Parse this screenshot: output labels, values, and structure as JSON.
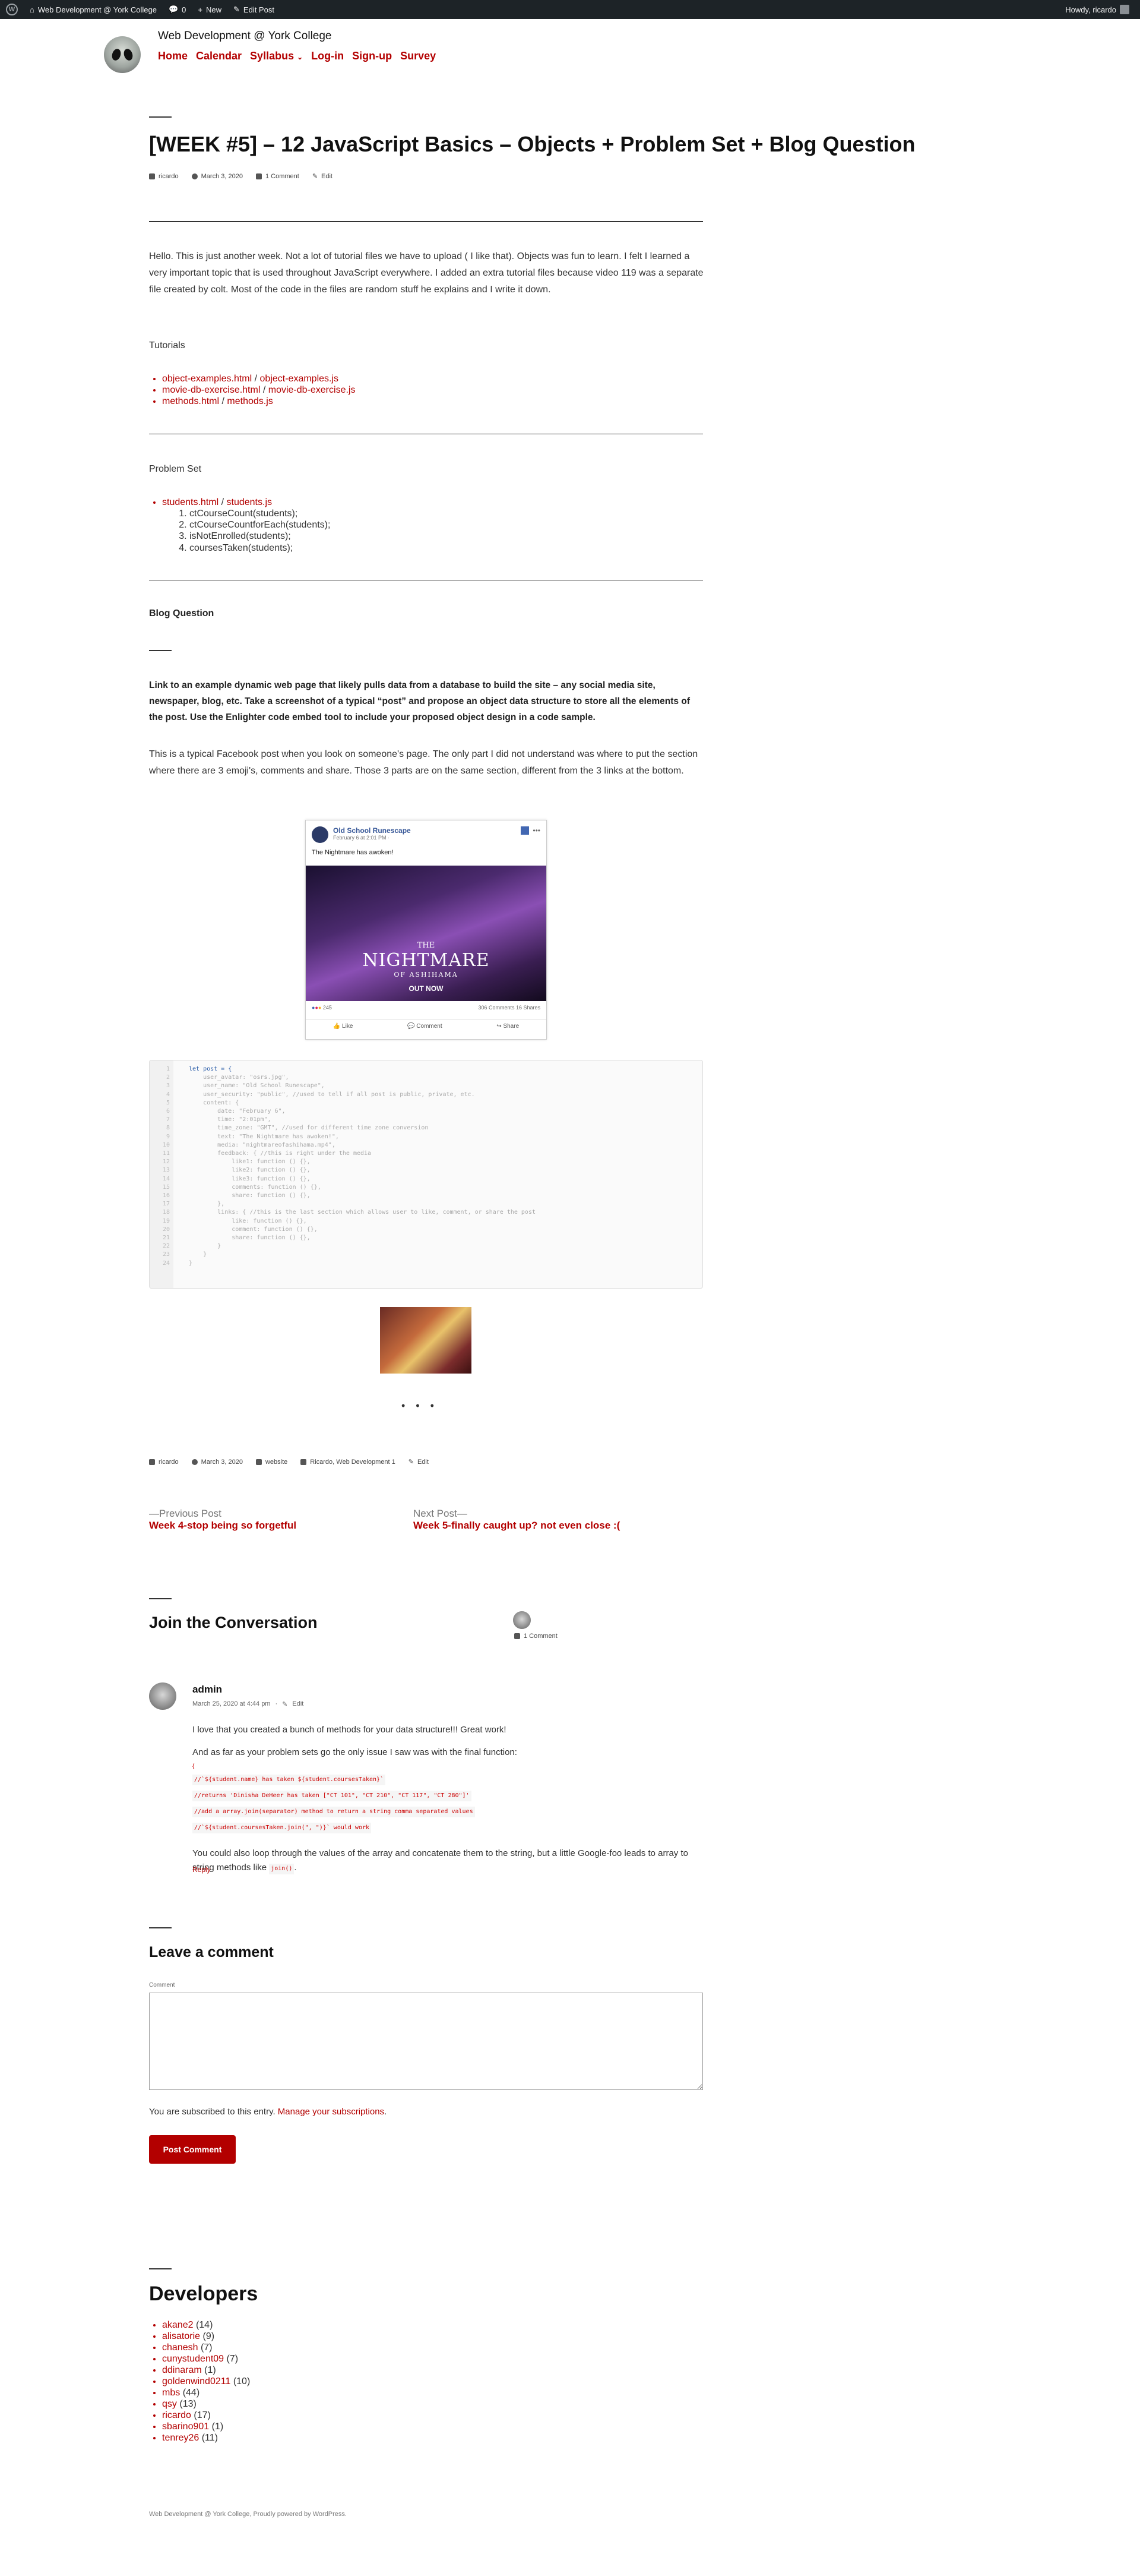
{
  "adminbar": {
    "site": "Web Development @ York College",
    "comments_count": "0",
    "new_label": "New",
    "edit_label": "Edit Post",
    "howdy": "Howdy, ricardo"
  },
  "site": {
    "title": "Web Development @ York College",
    "nav": [
      "Home",
      "Calendar",
      "Syllabus",
      "Log-in",
      "Sign-up",
      "Survey"
    ]
  },
  "post": {
    "title": "[WEEK #5] – 12 JavaScript Basics – Objects + Problem Set + Blog Question",
    "author": "ricardo",
    "date": "March 3, 2020",
    "comments": "1 Comment",
    "edit": "Edit",
    "intro": "Hello. This is just another week. Not a lot of tutorial files we have to upload ( I like that). Objects was fun to learn. I felt I learned a very important topic that is used throughout JavaScript everywhere. I added an extra tutorial files because video 119 was a separate file created by colt. Most of the code in the files are random stuff he explains and I write it down.",
    "tutorials_heading": "Tutorials",
    "tutorials": [
      {
        "a": "object-examples.html",
        "b": "object-examples.js"
      },
      {
        "a": "movie-db-exercise.html",
        "b": "movie-db-exercise.js"
      },
      {
        "a": "methods.html",
        "b": "methods.js"
      }
    ],
    "problem_heading": "Problem Set",
    "problem_files": {
      "a": "students.html",
      "b": "students.js"
    },
    "problems": [
      "ctCourseCount(students);",
      "ctCourseCountforEach(students);",
      "isNotEnrolled(students);",
      "coursesTaken(students);"
    ],
    "blog_heading": "Blog Question",
    "question": "Link to an example dynamic web page that likely pulls data from a database to build the site – any social media site, newspaper, blog, etc. Take a screenshot of a typical “post” and propose an object data structure to store all the elements of the post. Use the Enlighter code embed tool to include your proposed object design in a code sample.",
    "answer": "This is a typical Facebook post when you look on someone's page. The only part I did not understand was where to put the section where there are 3 emoji's, comments and share. Those 3 parts are on the same section, different from the 3 links at the bottom."
  },
  "fb_post": {
    "page_name": "Old School Runescape",
    "date": "February 6 at 2:01 PM · ",
    "text": "The Nightmare has awoken!",
    "image_title_1": "THE",
    "image_title_2": "NIGHTMARE",
    "image_title_3": "OF ASHIHAMA",
    "image_cta": "OUT NOW",
    "reactions": "245",
    "counts": "306 Comments  16 Shares",
    "actions": [
      "Like",
      "Comment",
      "Share"
    ]
  },
  "code": {
    "line_numbers": "1\n2\n3\n4\n5\n6\n7\n8\n9\n10\n11\n12\n13\n14\n15\n16\n17\n18\n19\n20\n21\n22\n23\n24",
    "first_line": "let post = {",
    "rest": "    user_avatar: \"osrs.jpg\",\n    user_name: \"Old School Runescape\",\n    user_security: \"public\", //used to tell if all post is public, private, etc.\n    content: {\n        date: \"February 6\",\n        time: \"2:01pm\",\n        time_zone: \"GMT\", //used for different time zone conversion\n        text: \"The Nightmare has awoken!\",\n        media: \"nightmareofashihama.mp4\",\n        feedback: { //this is right under the media\n            like1: function () {},\n            like2: function () {},\n            like3: function () {},\n            comments: function () {},\n            share: function () {},\n        },\n        links: { //this is the last section which allows user to like, comment, or share the post\n            like: function () {},\n            comment: function () {},\n            share: function () {},\n        }\n    }\n}"
  },
  "post_footer": {
    "author": "ricardo",
    "date": "March 3, 2020",
    "category": "website",
    "tags": "Ricardo, Web Development 1",
    "edit": "Edit"
  },
  "postnav": {
    "prev_label": "—Previous Post",
    "prev_title": "Week 4-stop being so forgetful",
    "next_label": "Next Post—",
    "next_title": "Week 5-finally caught up? not even close :("
  },
  "conversation": {
    "heading": "Join the Conversation",
    "count": "1 Comment"
  },
  "comment": {
    "author": "admin",
    "date": "March 25, 2020 at 4:44 pm",
    "edit": "Edit",
    "p1": "I love that you created a bunch of methods for your data structure!!! Great work!",
    "p2": "And as far as your problem sets go the only issue I saw was with the final function:",
    "code_lines": [
      "//`${student.name} has taken ${student.coursesTaken}`",
      "//returns 'Dinisha DeHeer has taken [\"CT 101\", \"CT 210\", \"CT 117\", \"CT 280\"]'",
      "//add a array.join(separator) method to return a string comma separated values",
      "//`${student.coursesTaken.join(\", \")}` would work"
    ],
    "p3": "You could also loop through the values of the array and concatenate them to the string, but a little Google-foo leads to array to string methods like",
    "p3_code": "join()",
    "reply": "Reply"
  },
  "leave": {
    "heading": "Leave a comment",
    "label": "Comment",
    "sub_text": "You are subscribed to this entry.",
    "sub_link": "Manage your subscriptions",
    "button": "Post Comment"
  },
  "developers": {
    "heading": "Developers",
    "list": [
      {
        "name": "akane2",
        "count": "(14)"
      },
      {
        "name": "alisatorie",
        "count": "(9)"
      },
      {
        "name": "chanesh",
        "count": "(7)"
      },
      {
        "name": "cunystudent09",
        "count": "(7)"
      },
      {
        "name": "ddinaram",
        "count": "(1)"
      },
      {
        "name": "goldenwind0211",
        "count": "(10)"
      },
      {
        "name": "mbs",
        "count": "(44)"
      },
      {
        "name": "qsy",
        "count": "(13)"
      },
      {
        "name": "ricardo",
        "count": "(17)"
      },
      {
        "name": "sbarino901",
        "count": "(1)"
      },
      {
        "name": "tenrey26",
        "count": "(11)"
      }
    ]
  },
  "footer": "Web Development @ York College, Proudly powered by WordPress."
}
